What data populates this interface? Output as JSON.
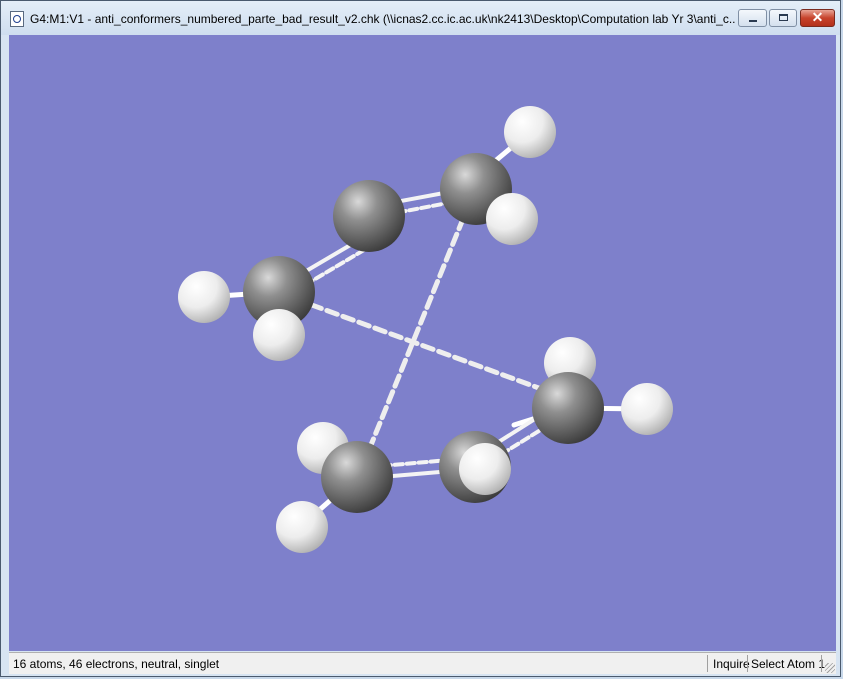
{
  "window": {
    "title": "G4:M1:V1 - anti_conformers_numbered_parte_bad_result_v2.chk (\\\\icnas2.cc.ic.ac.uk\\nk2413\\Desktop\\Computation lab Yr 3\\anti_c...",
    "icon": "gaussview-document-icon",
    "controls": {
      "minimize": "minimize-icon",
      "maximize": "maximize-icon",
      "close": "close-icon"
    }
  },
  "viewer": {
    "background_color": "#7e80cb",
    "carbon_color": "#8a8a8a",
    "hydrogen_color": "#f2f2f2",
    "bond_color": "#ffffff"
  },
  "status": {
    "summary": "16 atoms, 46 electrons, neutral, singlet",
    "mode": "Inquire",
    "action": "Select Atom 1"
  }
}
